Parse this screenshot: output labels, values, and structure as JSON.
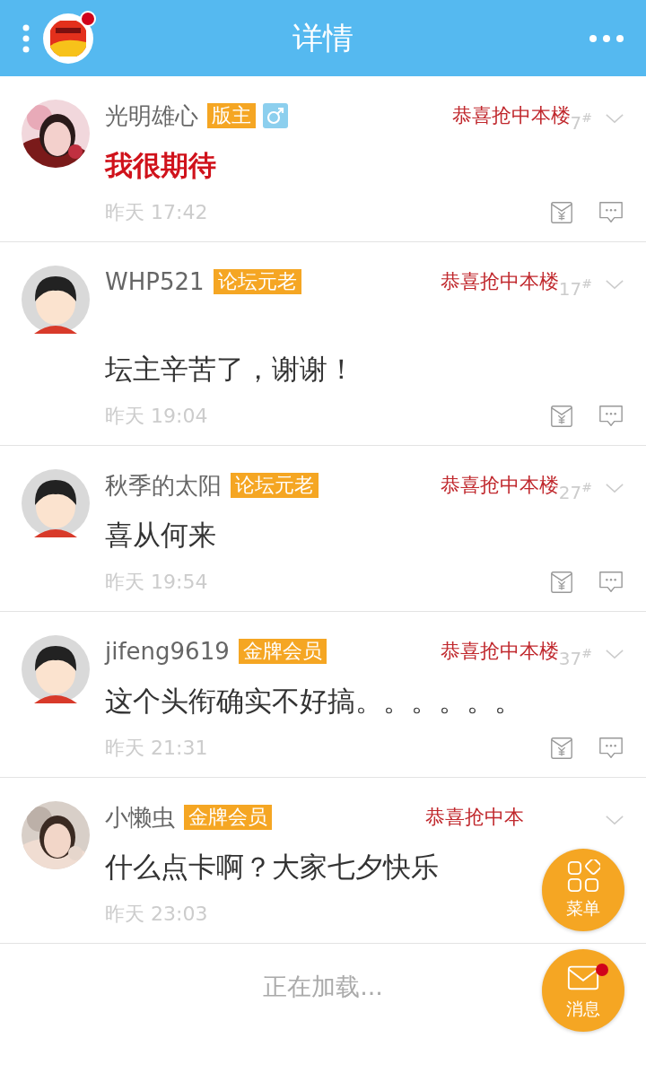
{
  "header": {
    "title": "详情",
    "logo_badge": true
  },
  "posts": [
    {
      "name": "光明雄心",
      "badge": "版主",
      "male": true,
      "award": "恭喜抢中本楼",
      "floor": "7$^{#}$",
      "content": "我很期待",
      "highlighted": true,
      "time": "昨天 17:42",
      "actions_visible": true
    },
    {
      "name": "WHP521",
      "badge": "论坛元老",
      "male": false,
      "avatar": {
        "kind": "default"
      },
      "award": "恭喜抢中本楼",
      "floor": "17$^{#}$",
      "content": "\n坛主辛苦了，谢谢！",
      "highlighted": false,
      "time": "昨天 19:04",
      "actions_visible": true
    },
    {
      "name": "秋季的太阳",
      "badge": "论坛元老",
      "male": false,
      "avatar": {
        "kind": "default"
      },
      "award": "恭喜抢中本楼",
      "floor": "27$^{#}$",
      "content": "喜从何来",
      "highlighted": false,
      "time": "昨天 19:54",
      "actions_visible": true
    },
    {
      "name": "jifeng9619",
      "badge": "金牌会员",
      "male": false,
      "avatar": {
        "kind": "default"
      },
      "award": "恭喜抢中本楼",
      "floor": "37$^{#}$",
      "content": "这个头衔确实不好搞。。。。。。",
      "highlighted": false,
      "time": "昨天 21:31",
      "actions_visible": true
    },
    {
      "name": "小懒虫",
      "badge": "金牌会员",
      "male": false,
      "award": "恭喜抢中本",
      "content": "什么点卡啊？大家七夕快乐",
      "highlighted": false,
      "time": "昨天 23:03",
      "actions_visible": false
    }
  ],
  "loading": "正在加载...",
  "fab": [
    {
      "kind": "menu",
      "label": "菜单",
      "badge": false
    },
    {
      "kind": "message",
      "label": "消息",
      "badge": true
    }
  ]
}
